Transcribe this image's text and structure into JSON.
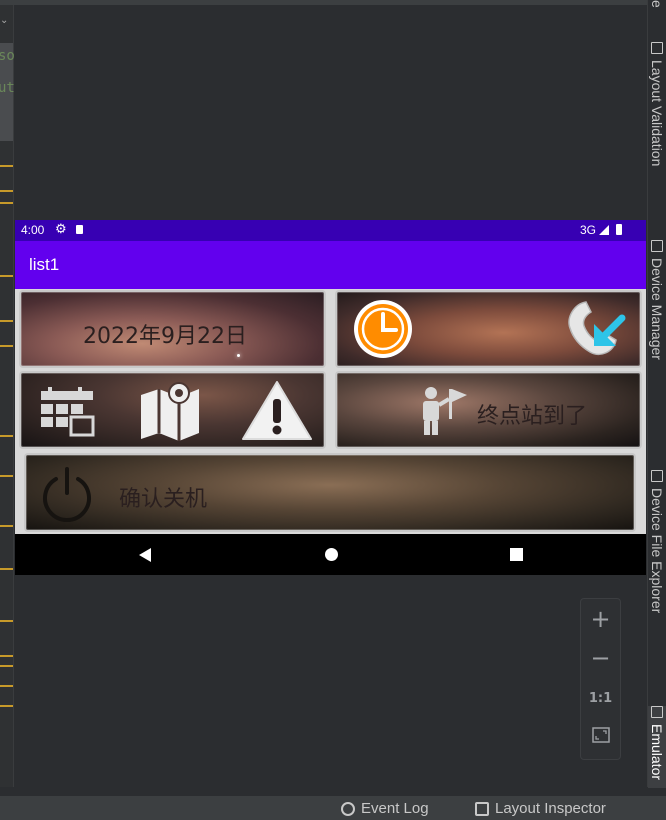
{
  "ide": {
    "side_tabs": [
      {
        "label": "e",
        "icon": "tab-icon"
      },
      {
        "label": "Layout Validation",
        "icon": "layout-validation-icon"
      },
      {
        "label": "Device Manager",
        "icon": "device-manager-icon"
      },
      {
        "label": "Device File Explorer",
        "icon": "file-explorer-icon"
      },
      {
        "label": "Emulator",
        "icon": "emulator-icon",
        "active": true
      }
    ],
    "bottom_items": [
      {
        "label": "Event Log",
        "icon": "event-log-icon"
      },
      {
        "label": "Layout Inspector",
        "icon": "layout-inspector-icon"
      }
    ],
    "code_fragments": [
      "so",
      "ut"
    ],
    "zoom": {
      "zoom_in": "+",
      "zoom_out": "−",
      "one_to_one": "1:1",
      "fit": "fit-screen-icon"
    }
  },
  "device": {
    "status_bar": {
      "time": "4:00",
      "network": "3G"
    },
    "app_title": "list1",
    "tiles": {
      "date_text": "2022年9月22日",
      "arrival_text": "终点站到了",
      "shutdown_text": "确认关机"
    },
    "icons": [
      "clock-icon",
      "phone-incoming-icon",
      "calendar-icon",
      "map-pin-icon",
      "warning-icon",
      "person-flag-icon",
      "power-icon"
    ]
  },
  "colors": {
    "status_bar": "#3700b3",
    "app_bar": "#6200ee",
    "clock_orange": "#ff8c00",
    "arrow_cyan": "#2ec4e8"
  }
}
